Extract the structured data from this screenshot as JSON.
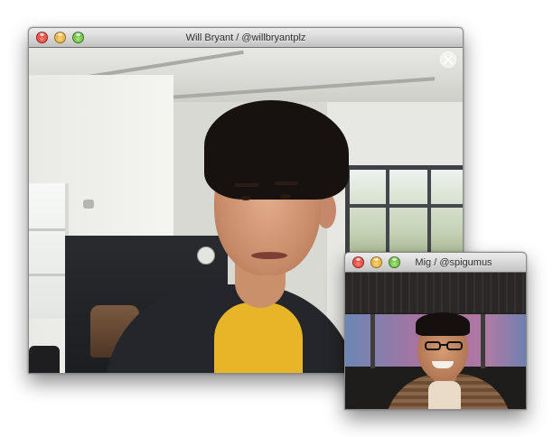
{
  "main_window": {
    "title": "Will Bryant / @willbryantplz",
    "traffic_lights": [
      "close",
      "minimize",
      "zoom"
    ],
    "fullscreen_icon": "fullscreen-arrows-icon"
  },
  "pip_window": {
    "title": "Mig / @spigumus",
    "traffic_lights": [
      "close",
      "minimize",
      "zoom"
    ]
  },
  "colors": {
    "close": "#d8241a",
    "minimize": "#e0a020",
    "zoom": "#4ea82a",
    "titlebar": "#d6d6d6",
    "shirt_yellow": "#e8b428"
  }
}
